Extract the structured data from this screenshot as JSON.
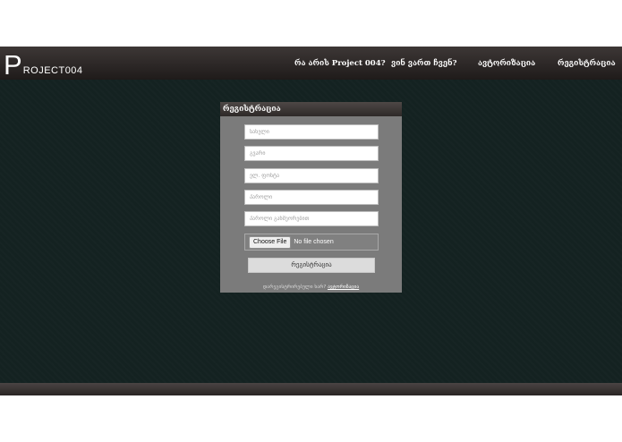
{
  "header": {
    "logo_initial": "P",
    "logo_rest": "ROJECT004",
    "nav": [
      {
        "label": "რა არის Project 004?"
      },
      {
        "label": "ვინ ვართ ჩვენ?"
      },
      {
        "label": "ავტორიზაცია"
      },
      {
        "label": "რეგისტრაცია"
      }
    ]
  },
  "form": {
    "title": "რეგისტრაცია",
    "fields": [
      {
        "placeholder": "სახელი"
      },
      {
        "placeholder": "გვარი"
      },
      {
        "placeholder": "ელ. ფოსტა"
      },
      {
        "placeholder": "პაროლი"
      },
      {
        "placeholder": "პაროლი განმეორებით"
      }
    ],
    "file_button": "Choose File",
    "file_status": "No file chosen",
    "submit_label": "რეგისტრაცია",
    "login_prompt": "დარეგისტრირებული ხარ?",
    "login_link": "ავტორიზაცია"
  },
  "colors": {
    "background": "#142221",
    "bar": "#2a2524",
    "panel": "#7b7b7b"
  }
}
